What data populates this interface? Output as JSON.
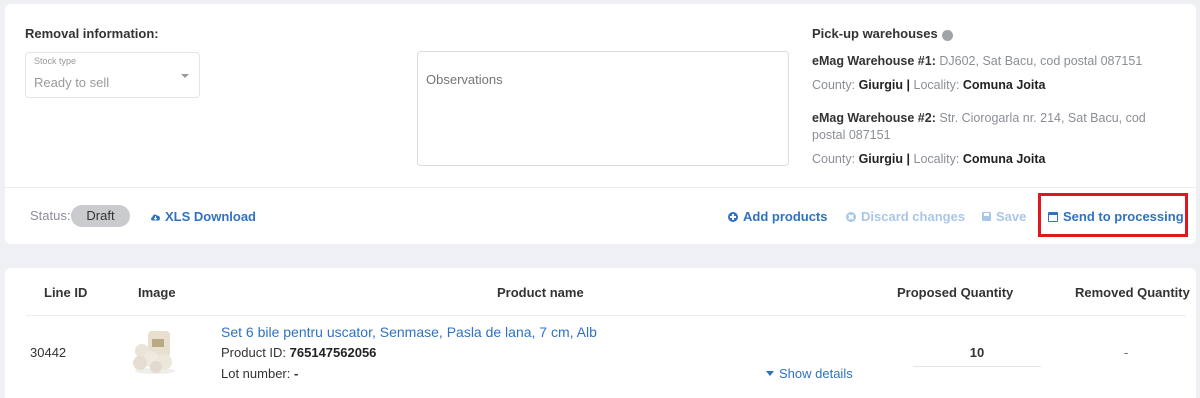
{
  "removal": {
    "title": "Removal information:",
    "stock_type_label": "Stock type",
    "stock_type_value": "Ready to sell",
    "observations_placeholder": "Observations"
  },
  "pickup": {
    "title": "Pick-up warehouses",
    "warehouses": [
      {
        "name": "eMag Warehouse #1:",
        "address": "DJ602, Sat Bacu, cod postal 087151",
        "county_label": "County:",
        "county": "Giurgiu",
        "separator": "|",
        "locality_label": "Locality:",
        "locality": "Comuna Joita"
      },
      {
        "name": "eMag Warehouse #2:",
        "address": "Str. Ciorogarla nr. 214, Sat Bacu, cod postal 087151",
        "county_label": "County:",
        "county": "Giurgiu",
        "separator": "|",
        "locality_label": "Locality:",
        "locality": "Comuna Joita"
      }
    ]
  },
  "toolbar": {
    "status_label": "Status:",
    "status_value": "Draft",
    "xls_download": "XLS Download",
    "add_products": "Add products",
    "discard_changes": "Discard changes",
    "save": "Save",
    "send_to_processing": "Send to processing"
  },
  "table": {
    "columns": [
      "Line ID",
      "Image",
      "Product name",
      "Proposed Quantity",
      "Removed Quantity"
    ],
    "rows": [
      {
        "line_id": "30442",
        "product_name": "Set 6 bile pentru uscator, Senmase, Pasla de lana, 7 cm, Alb",
        "product_id_label": "Product ID:",
        "product_id": "765147562056",
        "lot_label": "Lot number:",
        "lot": "-",
        "show_details": "Show details",
        "proposed_quantity": "10",
        "removed_quantity": "-"
      }
    ]
  },
  "colors": {
    "accent": "#2f72c4",
    "accent_disabled": "#a9c6ea",
    "highlight": "#e0171e",
    "status_badge": "#c9cbce"
  }
}
